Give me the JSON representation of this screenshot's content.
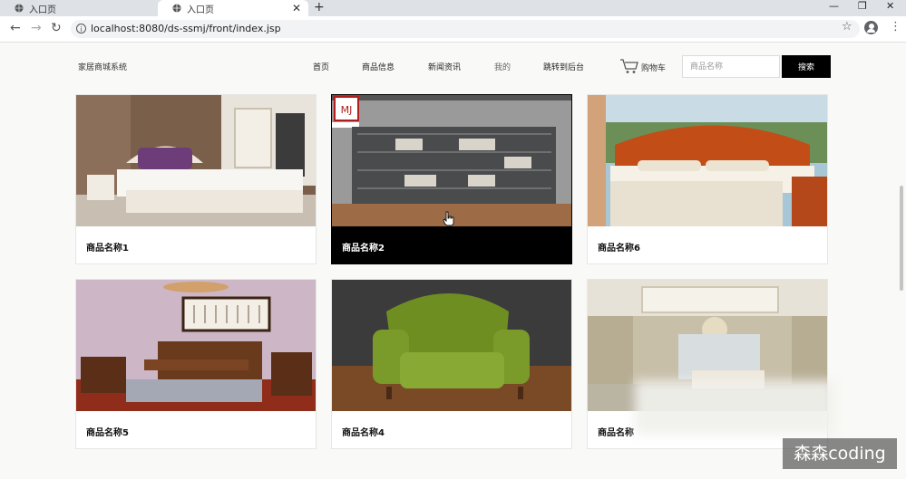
{
  "browser": {
    "tabs": [
      {
        "title": "入口页",
        "active": false
      },
      {
        "title": "入口页",
        "active": true
      }
    ],
    "url": "localhost:8080/ds-ssmj/front/index.jsp"
  },
  "header": {
    "site_title": "家居商城系统",
    "nav": [
      "首页",
      "商品信息",
      "新闻资讯",
      "我的",
      "跳转到后台"
    ],
    "cart_label": "购物车",
    "search_placeholder": "商品名称",
    "search_button": "搜索"
  },
  "products": [
    {
      "name": "商品名称1"
    },
    {
      "name": "商品名称2"
    },
    {
      "name": "商品名称6"
    },
    {
      "name": "商品名称5"
    },
    {
      "name": "商品名称4"
    },
    {
      "name": "商品名称"
    }
  ],
  "watermark": "森森coding",
  "colors": {
    "selected_card": "#000000",
    "search_button": "#000000",
    "page_bg": "#f9faf7"
  }
}
